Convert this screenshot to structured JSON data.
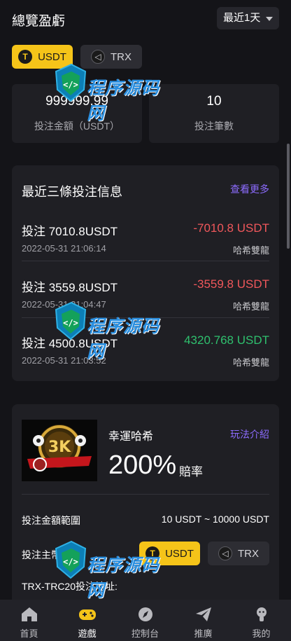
{
  "header": {
    "title": "總覽盈虧",
    "range_selected": "最近1天"
  },
  "coin_tabs": [
    {
      "label": "USDT",
      "icon": "usdt-icon",
      "active": true
    },
    {
      "label": "TRX",
      "icon": "trx-icon",
      "active": false
    }
  ],
  "stats": [
    {
      "value": "999999.99",
      "label": "投注金額（USDT）"
    },
    {
      "value": "10",
      "label": "投注筆數"
    }
  ],
  "recent": {
    "title": "最近三條投注信息",
    "more_label": "查看更多",
    "items": [
      {
        "amount": "投注 7010.8USDT",
        "time": "2022-05-31 21:06:14",
        "result": "-7010.8 USDT",
        "game": "哈希雙龍",
        "sign": "neg"
      },
      {
        "amount": "投注 3559.8USDT",
        "time": "2022-05-31 21:04:47",
        "result": "-3559.8 USDT",
        "game": "哈希雙龍",
        "sign": "neg"
      },
      {
        "amount": "投注 4500.8USDT",
        "time": "2022-05-31 21:03:52",
        "result": "4320.768 USDT",
        "game": "哈希雙龍",
        "sign": "pos"
      }
    ]
  },
  "game": {
    "name": "幸運哈希",
    "intro_label": "玩法介紹",
    "odds": "200%",
    "odds_label": "賠率",
    "range_label": "投注金額範圍",
    "range_value": "10 USDT ~ 10000 USDT",
    "coin_label": "投注主幣",
    "coin_options": [
      "USDT",
      "TRX"
    ],
    "address_label": "TRX-TRC20投注地址:"
  },
  "bottom_nav": [
    {
      "label": "首頁",
      "icon": "home-icon"
    },
    {
      "label": "遊戲",
      "icon": "gamepad-icon"
    },
    {
      "label": "控制台",
      "icon": "compass-icon"
    },
    {
      "label": "推廣",
      "icon": "paper-plane-icon"
    },
    {
      "label": "我的",
      "icon": "profile-icon"
    }
  ],
  "watermark": {
    "text": "程序源码网"
  },
  "colors": {
    "accent": "#f5c419",
    "link": "#8d6cff",
    "negative": "#f0575b",
    "positive": "#2fc06e"
  }
}
